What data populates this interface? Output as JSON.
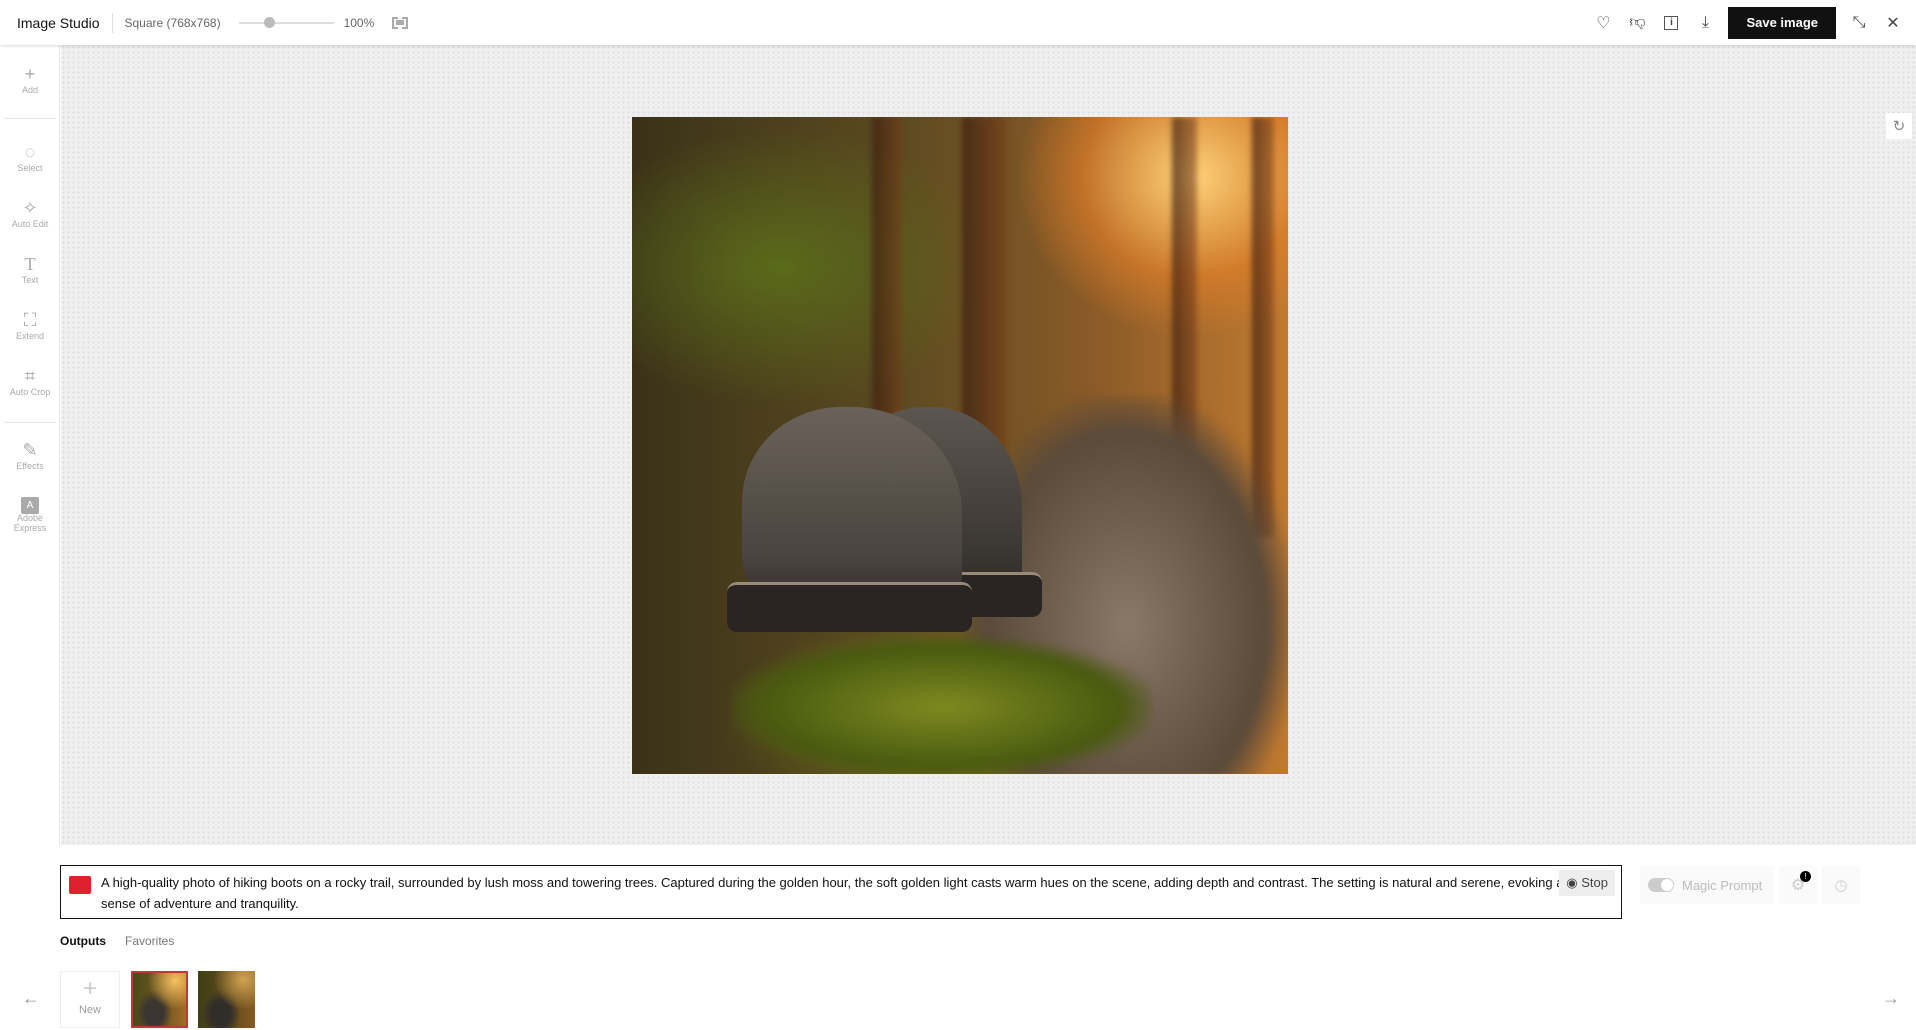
{
  "header": {
    "title": "Image Studio",
    "size": "Square (768x768)",
    "zoom": "100%",
    "zoom_slider_percent": 100,
    "save_label": "Save image",
    "icons": [
      "heart-icon",
      "thumbs-down-icon",
      "info-icon",
      "download-icon",
      "collapse-icon",
      "close-icon"
    ]
  },
  "sidebar": {
    "items": [
      {
        "label": "Add",
        "icon": "plus-icon"
      },
      {
        "label": "Select",
        "icon": "select-icon"
      },
      {
        "label": "Auto Edit",
        "icon": "sparkle-icon"
      },
      {
        "label": "Text",
        "icon": "text-icon"
      },
      {
        "label": "Extend",
        "icon": "extend-icon"
      },
      {
        "label": "Auto Crop",
        "icon": "crop-icon"
      },
      {
        "label": "Effects",
        "icon": "effects-icon"
      },
      {
        "label": "Adobe Express",
        "icon": "adobe-express-icon"
      }
    ]
  },
  "prompt": {
    "text": "A high-quality photo of hiking boots on a rocky trail, surrounded by lush moss and towering trees. Captured during the golden hour, the soft golden light casts warm hues on the scene, adding depth and contrast. The setting is natural and serene, evoking a sense of adventure and tranquility.",
    "stop_label": "Stop",
    "magic_prompt_label": "Magic Prompt",
    "settings_badge": "!"
  },
  "tabs": [
    {
      "label": "Outputs",
      "active": true
    },
    {
      "label": "Favorites",
      "active": false
    }
  ],
  "outputs": {
    "new_label": "New",
    "thumbnail_count": 2,
    "selected": 0
  },
  "colors": {
    "accent": "#111111",
    "brand": "#e0202e",
    "selected_border": "#b83a3a"
  }
}
